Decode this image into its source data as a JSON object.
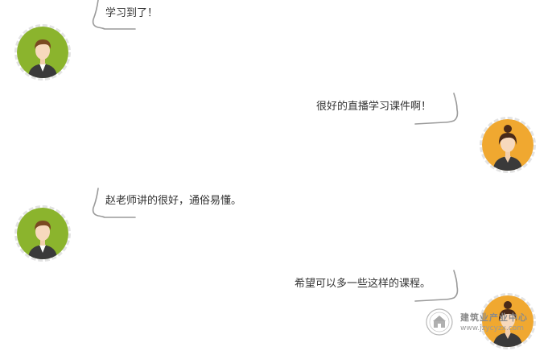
{
  "messages": [
    {
      "side": "left",
      "text": "学习到了！",
      "avatar": "male-avatar-icon"
    },
    {
      "side": "right",
      "text": "很好的直播学习课件啊！",
      "avatar": "female-avatar-icon"
    },
    {
      "side": "left",
      "text": "赵老师讲的很好，通俗易懂。",
      "avatar": "male-avatar-icon"
    },
    {
      "side": "right",
      "text": "希望可以多一些这样的课程。",
      "avatar": "female-avatar-icon"
    }
  ],
  "watermark": {
    "title": "建筑业产业中心",
    "url": "www.jzycyzx.com"
  },
  "colors": {
    "male_avatar_bg": "#8bb42d",
    "female_avatar_bg": "#f0a830",
    "text": "#333333"
  }
}
